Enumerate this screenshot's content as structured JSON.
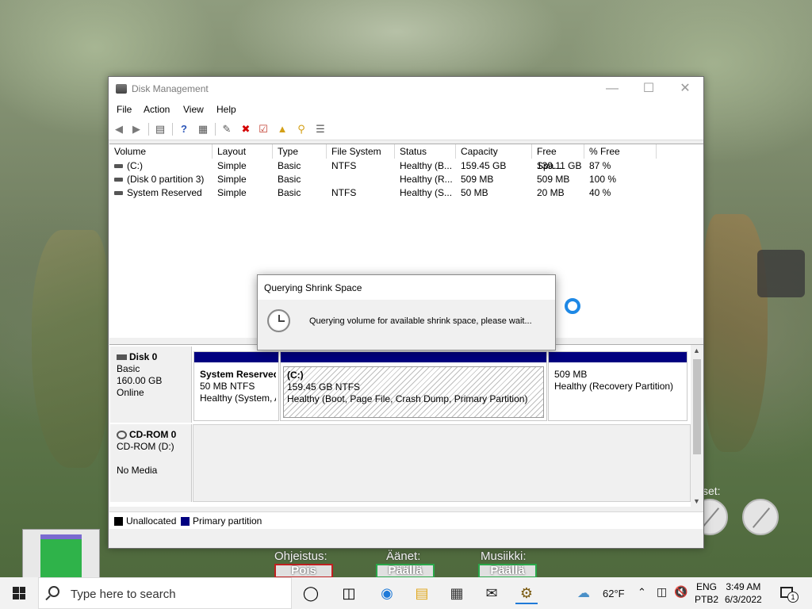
{
  "window": {
    "title": "Disk Management",
    "menu": [
      "File",
      "Action",
      "View",
      "Help"
    ]
  },
  "volume_list": {
    "columns": [
      "Volume",
      "Layout",
      "Type",
      "File System",
      "Status",
      "Capacity",
      "Free Spa...",
      "% Free"
    ],
    "rows": [
      [
        "(C:)",
        "Simple",
        "Basic",
        "NTFS",
        "Healthy (B...",
        "159.45 GB",
        "139.11 GB",
        "87 %"
      ],
      [
        "(Disk 0 partition 3)",
        "Simple",
        "Basic",
        "",
        "Healthy (R...",
        "509 MB",
        "509 MB",
        "100 %"
      ],
      [
        "System Reserved",
        "Simple",
        "Basic",
        "NTFS",
        "Healthy (S...",
        "50 MB",
        "20 MB",
        "40 %"
      ]
    ]
  },
  "disks": {
    "disk0": {
      "name": "Disk 0",
      "type": "Basic",
      "size": "160.00 GB",
      "status": "Online",
      "partitions": [
        {
          "name": "System Reserved",
          "size": "50 MB NTFS",
          "status": "Healthy (System, A"
        },
        {
          "name": "(C:)",
          "size": "159.45 GB NTFS",
          "status": "Healthy (Boot, Page File, Crash Dump, Primary Partition)"
        },
        {
          "name": "",
          "size": "509 MB",
          "status": "Healthy (Recovery Partition)"
        }
      ]
    },
    "cdrom0": {
      "name": "CD-ROM 0",
      "type": "CD-ROM (D:)",
      "status": "No Media"
    }
  },
  "legend": {
    "unallocated": "Unallocated",
    "primary": "Primary partition",
    "unallocated_color": "#000000",
    "primary_color": "#010080"
  },
  "dialog": {
    "title": "Querying Shrink Space",
    "message": "Querying volume for available shrink space, please wait..."
  },
  "background_game": {
    "labels": [
      "Ohjeistus:",
      "Äänet:",
      "Musiikki:"
    ],
    "buttons": [
      "Pois",
      "Päällä",
      "Päällä"
    ],
    "settings_label": "set:"
  },
  "taskbar": {
    "search_placeholder": "Type here to search",
    "weather": "62°F",
    "lang_top": "ENG",
    "lang_bottom": "PTB2",
    "time": "3:49 AM",
    "date": "6/3/2022",
    "notification_count": "1"
  },
  "icons": {
    "back": "back-arrow-icon",
    "forward": "forward-arrow-icon",
    "accent_blue": "#1e88e5"
  }
}
